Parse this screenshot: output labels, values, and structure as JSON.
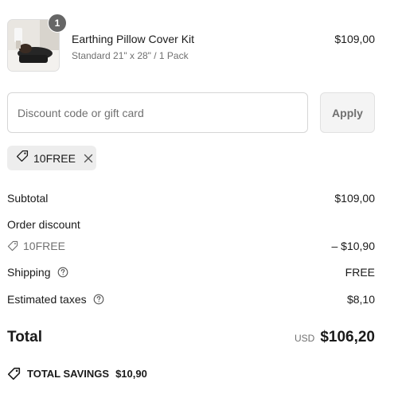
{
  "line_item": {
    "quantity": "1",
    "name": "Earthing Pillow Cover Kit",
    "variant": "Standard 21\" x 28\" / 1 Pack",
    "price": "$109,00"
  },
  "discount": {
    "placeholder": "Discount code or gift card",
    "apply_label": "Apply",
    "applied_code": "10FREE"
  },
  "summary": {
    "subtotal_label": "Subtotal",
    "subtotal_value": "$109,00",
    "order_discount_label": "Order discount",
    "discount_code": "10FREE",
    "discount_value": "– $10,90",
    "shipping_label": "Shipping",
    "shipping_value": "FREE",
    "taxes_label": "Estimated taxes",
    "taxes_value": "$8,10"
  },
  "total": {
    "label": "Total",
    "currency": "USD",
    "value": "$106,20"
  },
  "savings": {
    "label": "TOTAL SAVINGS",
    "value": "$10,90"
  },
  "icons": {
    "tag": "tag-icon",
    "close": "close-icon",
    "help": "help-circle-icon"
  }
}
